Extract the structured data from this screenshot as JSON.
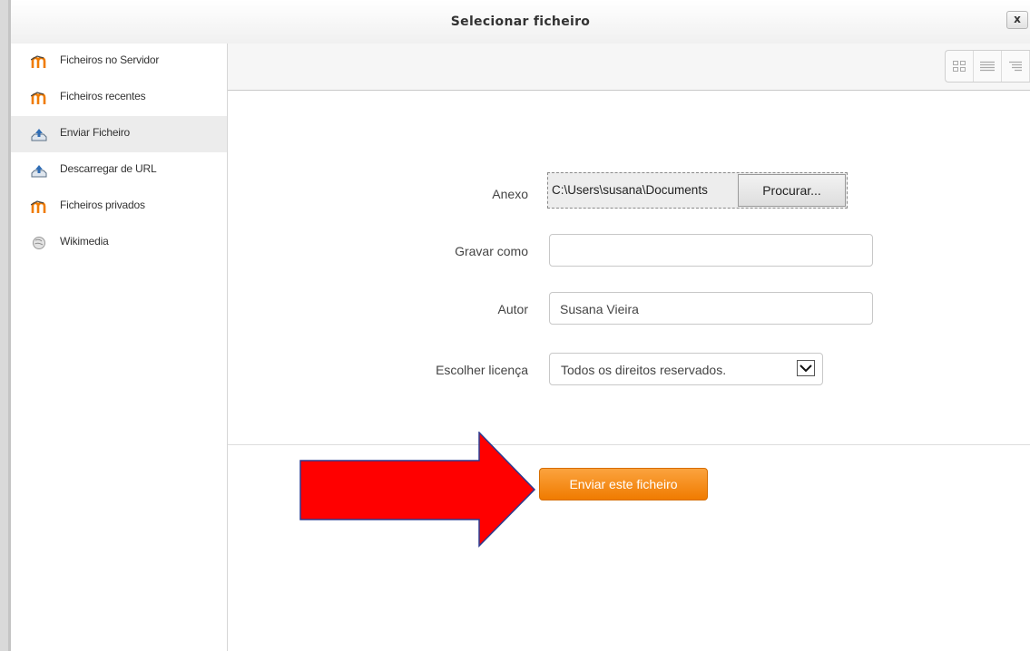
{
  "dialog": {
    "title": "Selecionar ficheiro",
    "close_label": "x"
  },
  "sidebar": {
    "items": [
      {
        "label": "Ficheiros no Servidor",
        "icon": "moodle-icon",
        "active": false
      },
      {
        "label": "Ficheiros recentes",
        "icon": "moodle-icon",
        "active": false
      },
      {
        "label": "Enviar Ficheiro",
        "icon": "upload-icon",
        "active": true
      },
      {
        "label": "Descarregar de URL",
        "icon": "upload-icon",
        "active": false
      },
      {
        "label": "Ficheiros privados",
        "icon": "moodle-icon",
        "active": false
      },
      {
        "label": "Wikimedia",
        "icon": "wikimedia-icon",
        "active": false
      }
    ]
  },
  "toolbar": {
    "views": [
      "icons-view",
      "list-view",
      "tree-view"
    ]
  },
  "form": {
    "attachment": {
      "label": "Anexo",
      "path": "C:\\Users\\susana\\Documents",
      "browse_label": "Procurar..."
    },
    "save_as": {
      "label": "Gravar como",
      "value": ""
    },
    "author": {
      "label": "Autor",
      "value": "Susana Vieira"
    },
    "license": {
      "label": "Escolher licença",
      "value": "Todos os direitos reservados."
    },
    "submit_label": "Enviar este ficheiro"
  },
  "colors": {
    "accent": "#f28a10",
    "arrow": "#ff0000",
    "arrow_outline": "#2b3a8f"
  }
}
